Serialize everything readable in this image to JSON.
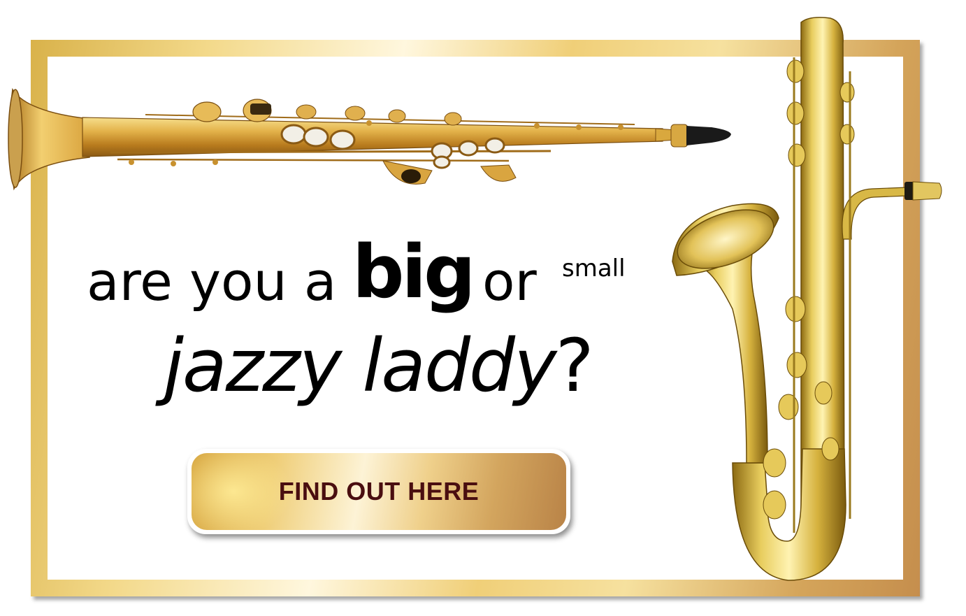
{
  "headline": {
    "word_are_you_a": "are you a",
    "word_big": "big",
    "word_or": "or",
    "word_small": "small",
    "line2_main": "jazzy laddy",
    "line2_punct": "?"
  },
  "cta": {
    "label": "FIND OUT HERE"
  },
  "colors": {
    "gold_light": "#f6e19f",
    "gold_dark": "#c58e4d",
    "cta_text": "#4a0e10",
    "text": "#000000",
    "background": "#ffffff"
  },
  "images": {
    "top_left": "soprano-saxophone",
    "right": "bass-saxophone"
  }
}
